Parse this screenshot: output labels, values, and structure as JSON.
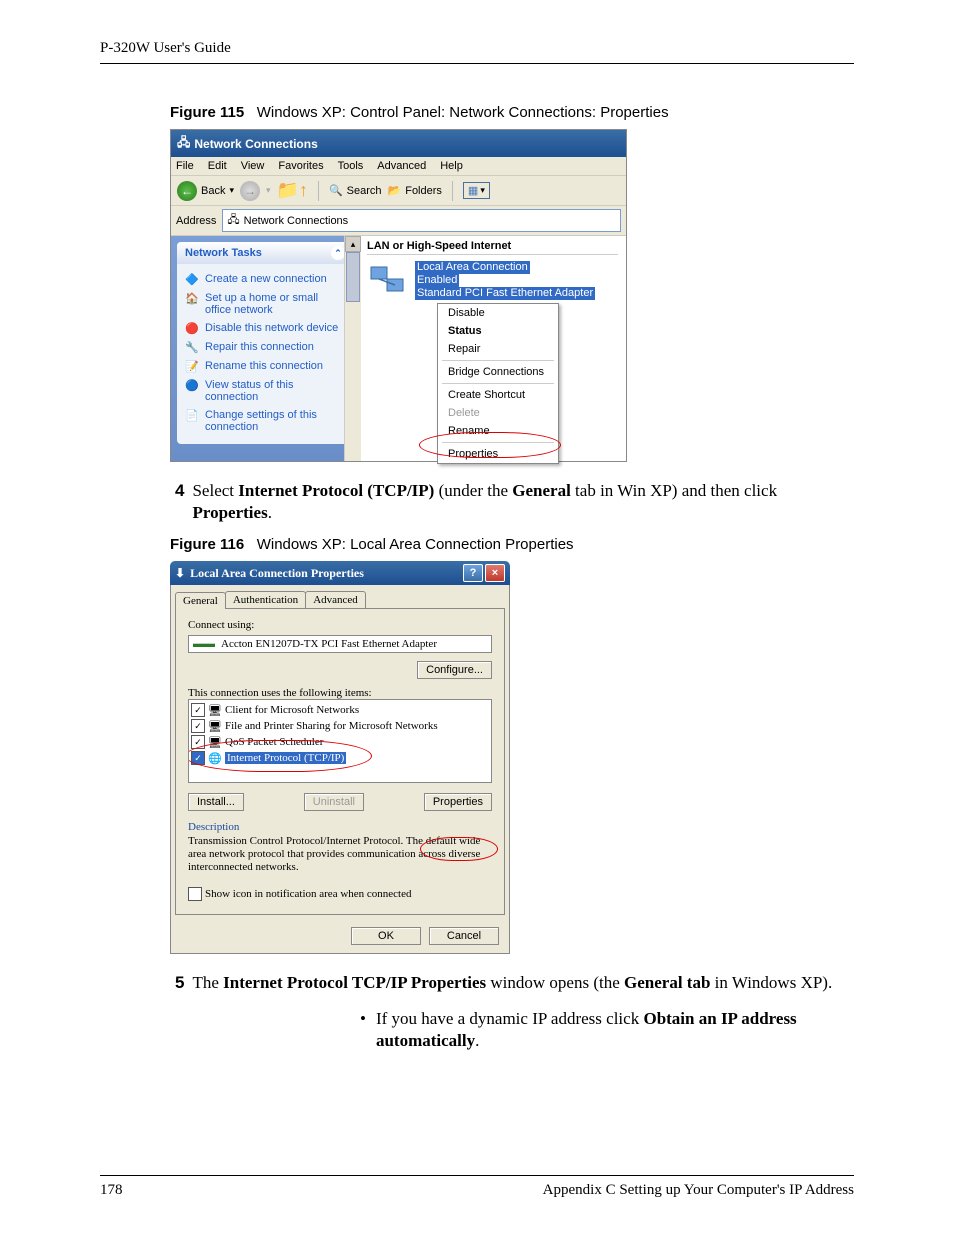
{
  "page": {
    "header": "P-320W User's Guide",
    "number": "178",
    "footer_right": "Appendix C Setting up Your Computer's IP Address"
  },
  "fig115": {
    "label": "Figure 115",
    "caption": "Windows XP: Control Panel: Network Connections: Properties",
    "title": "Network Connections",
    "menu": [
      "File",
      "Edit",
      "View",
      "Favorites",
      "Tools",
      "Advanced",
      "Help"
    ],
    "toolbar": {
      "back": "Back",
      "search": "Search",
      "folders": "Folders"
    },
    "address_label": "Address",
    "address_value": "Network Connections",
    "tasks_header": "Network Tasks",
    "tasks": [
      "Create a new connection",
      "Set up a home or small office network",
      "Disable this network device",
      "Repair this connection",
      "Rename this connection",
      "View status of this connection",
      "Change settings of this connection"
    ],
    "section": "LAN or High-Speed Internet",
    "item_name": "Local Area Connection",
    "item_status": "Enabled",
    "item_adapter": "Standard PCI Fast Ethernet Adapter",
    "context_menu": [
      "Disable",
      "Status",
      "Repair",
      "Bridge Connections",
      "Create Shortcut",
      "Delete",
      "Rename",
      "Properties"
    ]
  },
  "step4": {
    "num": "4",
    "pre": "Select ",
    "bold1": "Internet Protocol (TCP/IP)",
    "mid1": " (under the ",
    "bold2": "General",
    "mid2": " tab in Win XP) and then click ",
    "bold3": "Properties",
    "post": "."
  },
  "fig116": {
    "label": "Figure 116",
    "caption": "Windows XP: Local Area Connection Properties",
    "title": "Local Area Connection Properties",
    "tabs": [
      "General",
      "Authentication",
      "Advanced"
    ],
    "connect_label": "Connect using:",
    "adapter": "Accton EN1207D-TX PCI Fast Ethernet Adapter",
    "configure_btn": "Configure...",
    "uses_label": "This connection uses the following items:",
    "items": [
      "Client for Microsoft Networks",
      "File and Printer Sharing for Microsoft Networks",
      "QoS Packet Scheduler",
      "Internet Protocol (TCP/IP)"
    ],
    "install_btn": "Install...",
    "uninstall_btn": "Uninstall",
    "properties_btn": "Properties",
    "desc_label": "Description",
    "desc_text": "Transmission Control Protocol/Internet Protocol. The default wide area network protocol that provides communication across diverse interconnected networks.",
    "show_icon": "Show icon in notification area when connected",
    "ok": "OK",
    "cancel": "Cancel"
  },
  "step5": {
    "num": "5",
    "pre": "The ",
    "bold1": "Internet Protocol TCP/IP Properties",
    "mid1": " window opens (the ",
    "bold2": "General tab",
    "post": " in Windows XP)."
  },
  "bullet1": {
    "pre": "If you have a dynamic IP address click ",
    "bold": "Obtain an IP address automatically",
    "post": "."
  }
}
